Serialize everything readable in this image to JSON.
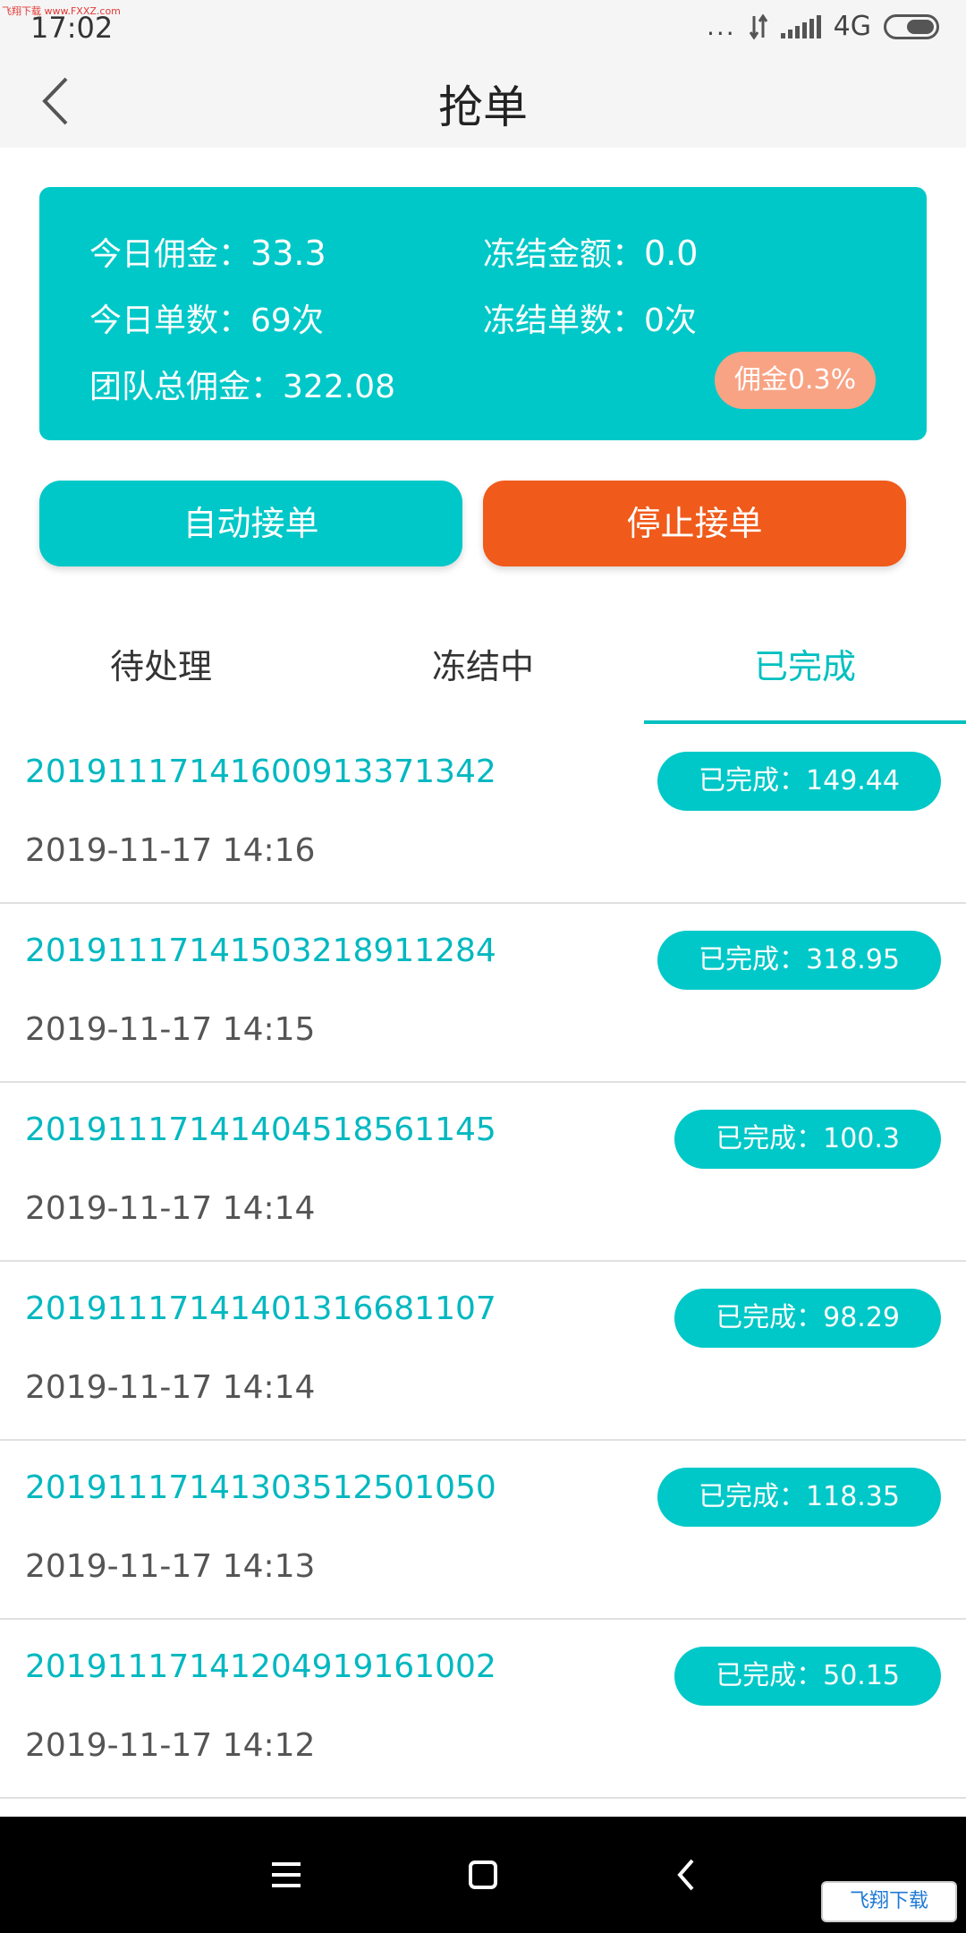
{
  "watermark_top": "飞翔下载 www.FXXZ.com",
  "status_bar": {
    "time": "17:02",
    "dots": "...",
    "network": "4G"
  },
  "header": {
    "title": "抢单"
  },
  "stats": {
    "today_commission_label": "今日佣金：",
    "today_commission_value": "33.3",
    "frozen_amount_label": "冻结金额：",
    "frozen_amount_value": "0.0",
    "today_orders_label": "今日单数：",
    "today_orders_value": "69次",
    "frozen_orders_label": "冻结单数：",
    "frozen_orders_value": "0次",
    "team_commission_label": "团队总佣金：",
    "team_commission_value": "322.08",
    "commission_rate": "佣金0.3%"
  },
  "actions": {
    "auto_label": "自动接单",
    "stop_label": "停止接单"
  },
  "tabs": [
    {
      "label": "待处理"
    },
    {
      "label": "冻结中"
    },
    {
      "label": "已完成"
    }
  ],
  "orders": [
    {
      "id": "20191117141600913371342",
      "time": "2019-11-17 14:16",
      "status": "已完成：149.44"
    },
    {
      "id": "20191117141503218911284",
      "time": "2019-11-17 14:15",
      "status": "已完成：318.95"
    },
    {
      "id": "20191117141404518561145",
      "time": "2019-11-17 14:14",
      "status": "已完成：100.3"
    },
    {
      "id": "20191117141401316681107",
      "time": "2019-11-17 14:14",
      "status": "已完成：98.29"
    },
    {
      "id": "20191117141303512501050",
      "time": "2019-11-17 14:13",
      "status": "已完成：118.35"
    },
    {
      "id": "20191117141204919161002",
      "time": "2019-11-17 14:12",
      "status": "已完成：50.15"
    }
  ],
  "watermark_bottom": "飞翔下载",
  "colors": {
    "teal": "#00c8c8",
    "orange": "#f05a1a",
    "badge": "#f8a384"
  }
}
